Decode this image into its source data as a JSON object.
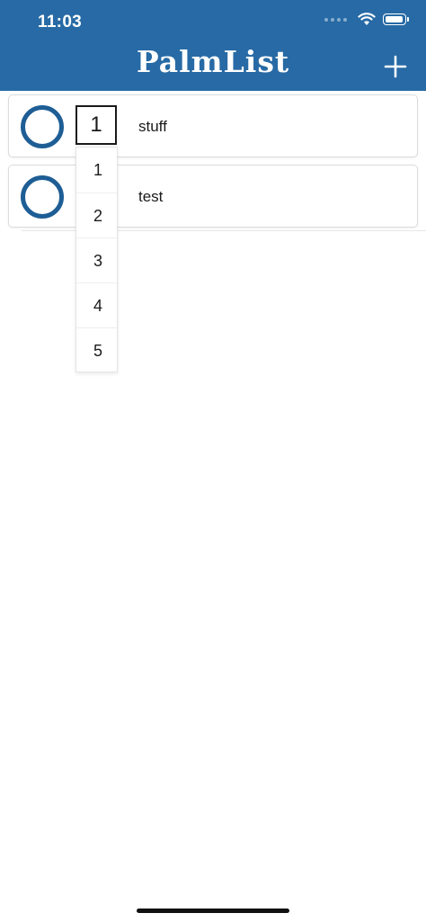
{
  "status_bar": {
    "time": "11:03",
    "icons": [
      "signal-dots-icon",
      "wifi-icon",
      "battery-icon"
    ]
  },
  "header": {
    "title": "PalmList",
    "add_icon": "plus-icon"
  },
  "tasks": [
    {
      "label": "stuff",
      "priority": "1"
    },
    {
      "label": "test"
    }
  ],
  "priority_dropdown": {
    "options": [
      "1",
      "2",
      "3",
      "4",
      "5"
    ]
  },
  "colors": {
    "header_bg": "#276aa5",
    "circle_stroke": "#1e5e95"
  }
}
